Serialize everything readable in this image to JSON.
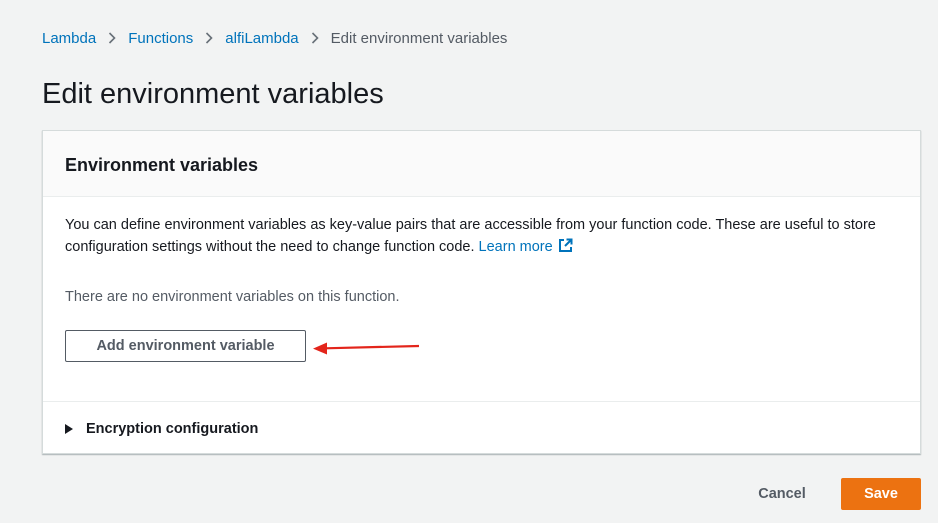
{
  "breadcrumb": {
    "items": [
      {
        "label": "Lambda"
      },
      {
        "label": "Functions"
      },
      {
        "label": "alfiLambda"
      }
    ],
    "current": "Edit environment variables"
  },
  "page": {
    "title": "Edit environment variables"
  },
  "panel": {
    "title": "Environment variables",
    "description": "You can define environment variables as key-value pairs that are accessible from your function code. These are useful to store configuration settings without the need to change function code.",
    "learn_more": "Learn more",
    "empty_message": "There are no environment variables on this function.",
    "add_button": "Add environment variable",
    "encryption_label": "Encryption configuration"
  },
  "footer": {
    "cancel": "Cancel",
    "save": "Save"
  },
  "colors": {
    "link": "#0073bb",
    "primary": "#ec7211",
    "annotation": "#e3251b",
    "background": "#f2f3f3"
  },
  "icons": {
    "breadcrumb_separator": "chevron-right-icon",
    "learn_more": "external-link-icon",
    "expand": "caret-right-icon"
  }
}
